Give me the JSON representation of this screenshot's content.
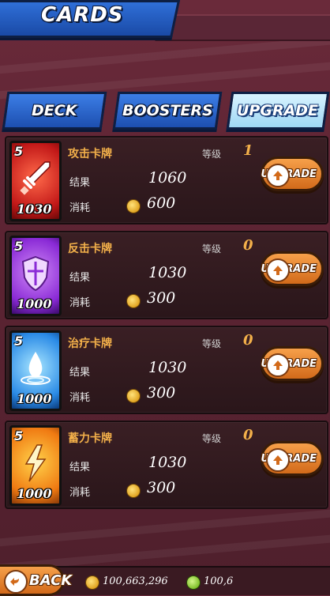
{
  "header": {
    "title": "CARDS"
  },
  "tabs": [
    {
      "label": "DECK",
      "active": false
    },
    {
      "label": "BOOSTERS",
      "active": false
    },
    {
      "label": "UPGRADE",
      "active": true
    }
  ],
  "labels": {
    "level": "等级",
    "result": "结果",
    "cost": "消耗",
    "upgrade_button": "UPGRADE"
  },
  "cards": [
    {
      "name": "攻击卡牌",
      "card_level": "5",
      "card_value": "1030",
      "level": "1",
      "result": "1060",
      "cost": "600",
      "icon": "sword-icon",
      "color": "#e23a2a"
    },
    {
      "name": "反击卡牌",
      "card_level": "5",
      "card_value": "1000",
      "level": "0",
      "result": "1030",
      "cost": "300",
      "icon": "shield-icon",
      "color": "#8a3ad6"
    },
    {
      "name": "治疗卡牌",
      "card_level": "5",
      "card_value": "1000",
      "level": "0",
      "result": "1030",
      "cost": "300",
      "icon": "water-drop-icon",
      "color": "#2f9ae6"
    },
    {
      "name": "蓄力卡牌",
      "card_level": "5",
      "card_value": "1000",
      "level": "0",
      "result": "1030",
      "cost": "300",
      "icon": "lightning-icon",
      "color": "#f08a1a"
    }
  ],
  "footer": {
    "back_label": "BACK",
    "coins": "100,663,296",
    "gems": "100,6"
  }
}
